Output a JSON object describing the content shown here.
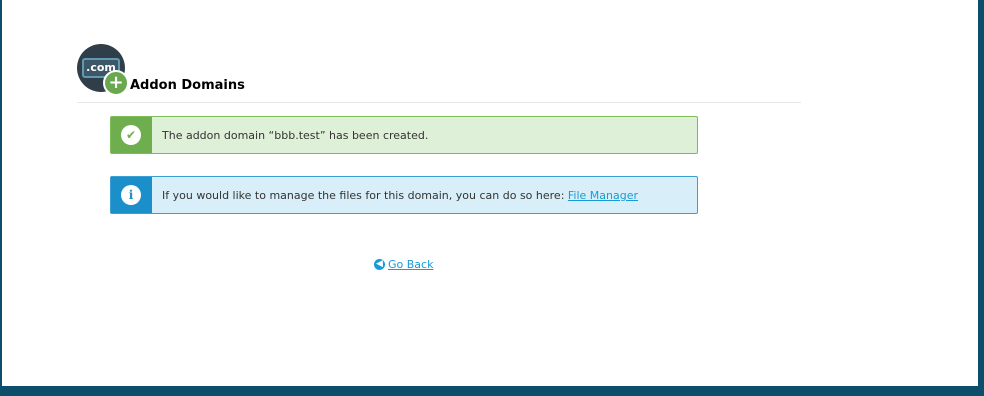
{
  "header": {
    "title": "Addon Domains",
    "icon_text": ".com",
    "icon_name": "addon-domain-icon"
  },
  "alerts": {
    "success": {
      "message": "The addon domain “bbb.test” has been created.",
      "icon": "check-icon",
      "color": "#6fae4e"
    },
    "info": {
      "message": "If you would like to manage the files for this domain, you can do so here: ",
      "link_text": "File Manager",
      "icon": "info-icon",
      "color": "#1b8fca"
    }
  },
  "actions": {
    "go_back": "Go Back"
  },
  "colors": {
    "link": "#179bd7",
    "frame": "#0d4f6b"
  }
}
